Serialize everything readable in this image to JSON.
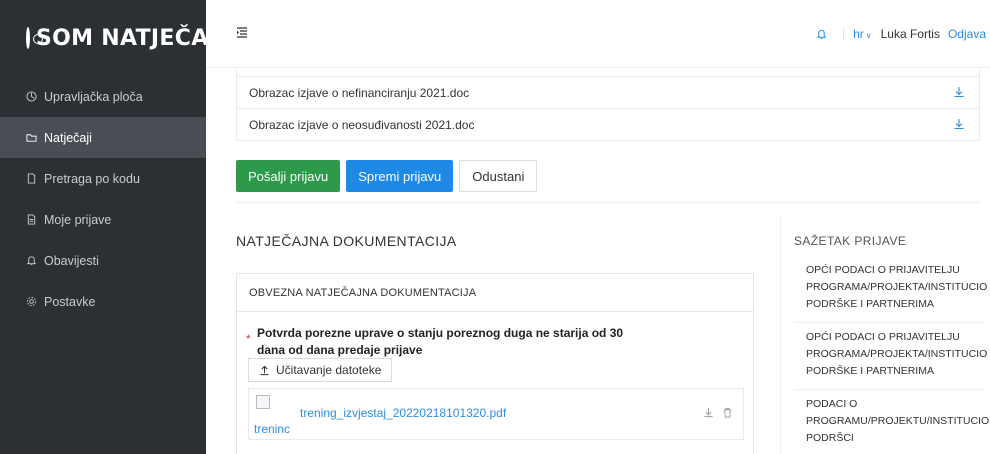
{
  "app": {
    "brand": "SOM NATJEČAJI"
  },
  "sidebar": {
    "items": [
      {
        "label": "Upravljačka ploča",
        "icon": "dashboard-icon"
      },
      {
        "label": "Natječaji",
        "icon": "folder-icon",
        "active": true
      },
      {
        "label": "Pretraga po kodu",
        "icon": "document-icon"
      },
      {
        "label": "Moje prijave",
        "icon": "document-icon"
      },
      {
        "label": "Obavijesti",
        "icon": "bell-icon"
      },
      {
        "label": "Postavke",
        "icon": "gear-icon"
      }
    ]
  },
  "topbar": {
    "language": "hr",
    "user": "Luka Fortis",
    "logout": "Odjava"
  },
  "documents": {
    "rows": [
      {
        "name": "Obrazac izjave o nefinanciranju 2021.doc"
      },
      {
        "name": "Obrazac izjave o neosuđivanosti 2021.doc"
      }
    ]
  },
  "actions": {
    "submit": "Pošalji prijavu",
    "save": "Spremi prijavu",
    "cancel": "Odustani"
  },
  "tender_docs": {
    "title": "NATJEČAJNA DOKUMENTACIJA",
    "mandatory_header": "OBVEZNA NATJEČAJNA DOKUMENTACIJA",
    "requirement_text": "Potvrda porezne uprave o stanju poreznog duga ne starija od 30 dana od dana predaje prijave",
    "upload_label": "Učitavanje datoteke",
    "file": {
      "name": "trening_izvjestaj_20220218101320.pdf",
      "alt": "treninc"
    }
  },
  "summary": {
    "title": "SAŽETAK PRIJAVE",
    "items": [
      "OPĆI PODACI O PRIJAVITELJU PROGRAMA/PROJEKTA/INSTITUCIO PODRŠKE i PARTNERIMA",
      "OPĆI PODACI O PRIJAVITELJU PROGRAMA/PROJEKTA/INSTITUCIO PODRŠKE i PARTNERIMA",
      "PODACI O PROGRAMU/PROJEKTU/INSTITUCIO PODRŠCI"
    ]
  },
  "colors": {
    "sidebar_bg": "#2c2f33",
    "sidebar_active": "#4a4e54",
    "accent_blue": "#1f8ae6",
    "accent_green": "#2c9a4a",
    "required_red": "#d93a3a"
  }
}
